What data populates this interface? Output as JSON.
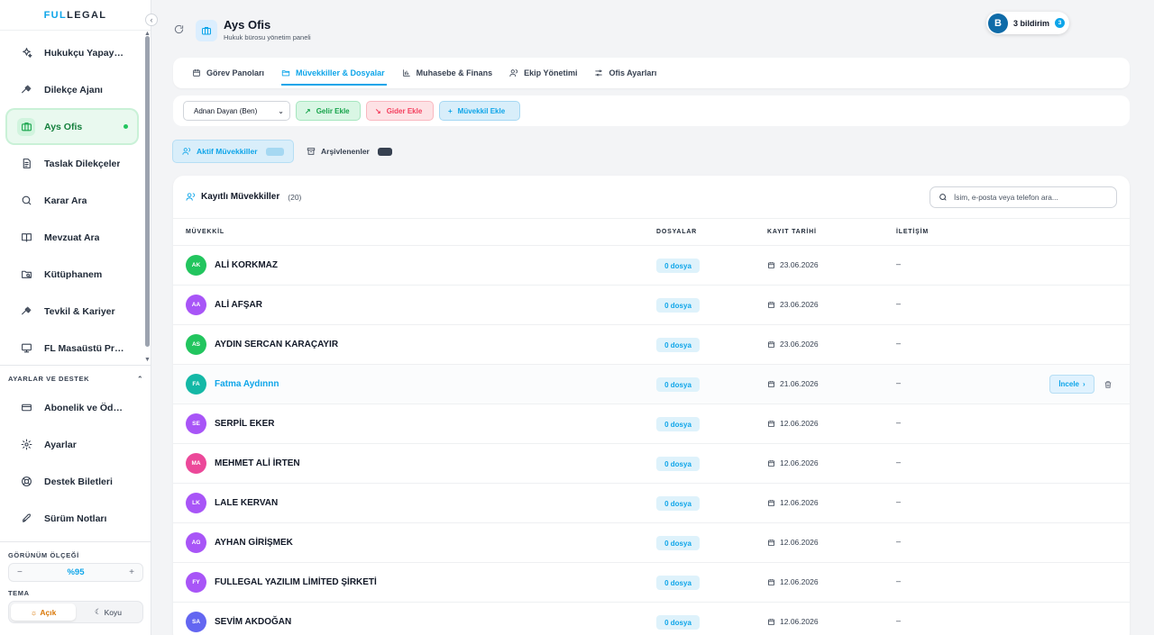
{
  "brand": {
    "part1": "FUL",
    "part2": "LEGAL"
  },
  "sidebar": {
    "items": [
      {
        "label": "Hukukçu Yapay Zeka",
        "icon": "sparkles-icon"
      },
      {
        "label": "Dilekçe Ajanı",
        "icon": "gavel-icon"
      },
      {
        "label": "Ays Ofis",
        "icon": "briefcase-icon",
        "active": true
      },
      {
        "label": "Taslak Dilekçeler",
        "icon": "document-icon"
      },
      {
        "label": "Karar Ara",
        "icon": "search-icon"
      },
      {
        "label": "Mevzuat Ara",
        "icon": "book-icon"
      },
      {
        "label": "Kütüphanem",
        "icon": "folder-search-icon"
      },
      {
        "label": "Tevkil & Kariyer",
        "icon": "gavel-icon"
      },
      {
        "label": "FL Masaüstü Programı",
        "icon": "monitor-icon"
      }
    ],
    "settings_title": "AYARLAR VE DESTEK",
    "settings_items": [
      {
        "label": "Abonelik ve Ödemeler",
        "icon": "credit-card-icon"
      },
      {
        "label": "Ayarlar",
        "icon": "gear-icon"
      },
      {
        "label": "Destek Biletleri",
        "icon": "lifebuoy-icon"
      },
      {
        "label": "Sürüm Notları",
        "icon": "rocket-icon"
      }
    ],
    "scale_title": "GÖRÜNÜM ÖLÇEĞİ",
    "scale_value": "%95",
    "theme_title": "TEMA",
    "theme_light": "Açık",
    "theme_dark": "Koyu"
  },
  "header": {
    "title": "Ays Ofis",
    "subtitle": "Hukuk bürosu yönetim paneli",
    "notif_label": "3 bildirim",
    "notif_count": "3",
    "avatar_letter": "B"
  },
  "tabs": [
    {
      "label": "Görev Panoları",
      "icon": "calendar-icon"
    },
    {
      "label": "Müvekkiller & Dosyalar",
      "icon": "folder-icon",
      "active": true
    },
    {
      "label": "Muhasebe & Finans",
      "icon": "bar-chart-icon"
    },
    {
      "label": "Ekip Yönetimi",
      "icon": "users-icon"
    },
    {
      "label": "Ofis Ayarları",
      "icon": "sliders-icon"
    }
  ],
  "actions": {
    "select_value": "Adnan Dayan (Ben)",
    "gelir": "Gelir Ekle",
    "gider": "Gider Ekle",
    "muvekkil": "Müvekkil Ekle"
  },
  "subtabs": {
    "active": "Aktif Müvekkiller",
    "archived": "Arşivlenenler"
  },
  "card": {
    "title": "Kayıtlı Müvekkiller",
    "count": "(20)",
    "search_placeholder": "İsim, e-posta veya telefon ara...",
    "columns": [
      "MÜVEKKİL",
      "DOSYALAR",
      "KAYIT TARİHİ",
      "İLETİŞİM"
    ],
    "incele": "İncele",
    "rows": [
      {
        "initials": "AK",
        "name": "ALİ KORKMAZ",
        "files": "0 dosya",
        "date": "23.06.2026",
        "contact": "–",
        "color": "#22c55e"
      },
      {
        "initials": "AA",
        "name": "ALİ AFŞAR",
        "files": "0 dosya",
        "date": "23.06.2026",
        "contact": "–",
        "color": "#a855f7"
      },
      {
        "initials": "AS",
        "name": "AYDIN SERCAN KARAÇAYIR",
        "files": "0 dosya",
        "date": "23.06.2026",
        "contact": "–",
        "color": "#22c55e"
      },
      {
        "initials": "FA",
        "name": "Fatma Aydınnn",
        "files": "0 dosya",
        "date": "21.06.2026",
        "contact": "–",
        "color": "#14b8a6",
        "hover": true
      },
      {
        "initials": "SE",
        "name": "SERPİL EKER",
        "files": "0 dosya",
        "date": "12.06.2026",
        "contact": "–",
        "color": "#a855f7"
      },
      {
        "initials": "MA",
        "name": "MEHMET ALİ İRTEN",
        "files": "0 dosya",
        "date": "12.06.2026",
        "contact": "–",
        "color": "#ec4899"
      },
      {
        "initials": "LK",
        "name": "LALE KERVAN",
        "files": "0 dosya",
        "date": "12.06.2026",
        "contact": "–",
        "color": "#a855f7"
      },
      {
        "initials": "AG",
        "name": "AYHAN GİRİŞMEK",
        "files": "0 dosya",
        "date": "12.06.2026",
        "contact": "–",
        "color": "#a855f7"
      },
      {
        "initials": "FY",
        "name": "FULLEGAL YAZILIM LİMİTED ŞİRKETİ",
        "files": "0 dosya",
        "date": "12.06.2026",
        "contact": "–",
        "color": "#a855f7"
      },
      {
        "initials": "SA",
        "name": "SEVİM AKDOĞAN",
        "files": "0 dosya",
        "date": "12.06.2026",
        "contact": "–",
        "color": "#6366f1"
      }
    ]
  }
}
